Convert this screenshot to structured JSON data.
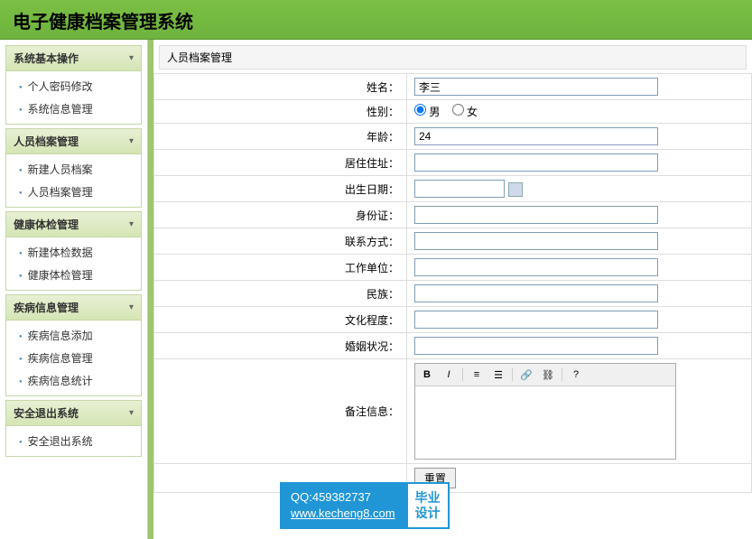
{
  "header": {
    "title": "电子健康档案管理系统"
  },
  "sidebar": {
    "groups": [
      {
        "title": "系统基本操作",
        "items": [
          "个人密码修改",
          "系统信息管理"
        ]
      },
      {
        "title": "人员档案管理",
        "items": [
          "新建人员档案",
          "人员档案管理"
        ]
      },
      {
        "title": "健康体检管理",
        "items": [
          "新建体检数据",
          "健康体检管理"
        ]
      },
      {
        "title": "疾病信息管理",
        "items": [
          "疾病信息添加",
          "疾病信息管理",
          "疾病信息统计"
        ]
      },
      {
        "title": "安全退出系统",
        "items": [
          "安全退出系统"
        ]
      }
    ]
  },
  "panel": {
    "title": "人员档案管理"
  },
  "form": {
    "name": {
      "label": "姓名：",
      "value": "李三"
    },
    "gender": {
      "label": "性别：",
      "male": "男",
      "female": "女"
    },
    "age": {
      "label": "年龄：",
      "value": "24"
    },
    "address": {
      "label": "居住住址：",
      "value": ""
    },
    "birth": {
      "label": "出生日期：",
      "value": ""
    },
    "idcard": {
      "label": "身份证：",
      "value": ""
    },
    "contact": {
      "label": "联系方式：",
      "value": ""
    },
    "work": {
      "label": "工作单位：",
      "value": ""
    },
    "ethnic": {
      "label": "民族：",
      "value": ""
    },
    "edu": {
      "label": "文化程度：",
      "value": ""
    },
    "marital": {
      "label": "婚姻状况：",
      "value": ""
    },
    "remark": {
      "label": "备注信息：",
      "value": ""
    },
    "reset": "重置"
  },
  "watermark": {
    "qq": "QQ:459382737",
    "url": "www.kecheng8.com",
    "brand1": "毕业",
    "brand2": "设计"
  }
}
